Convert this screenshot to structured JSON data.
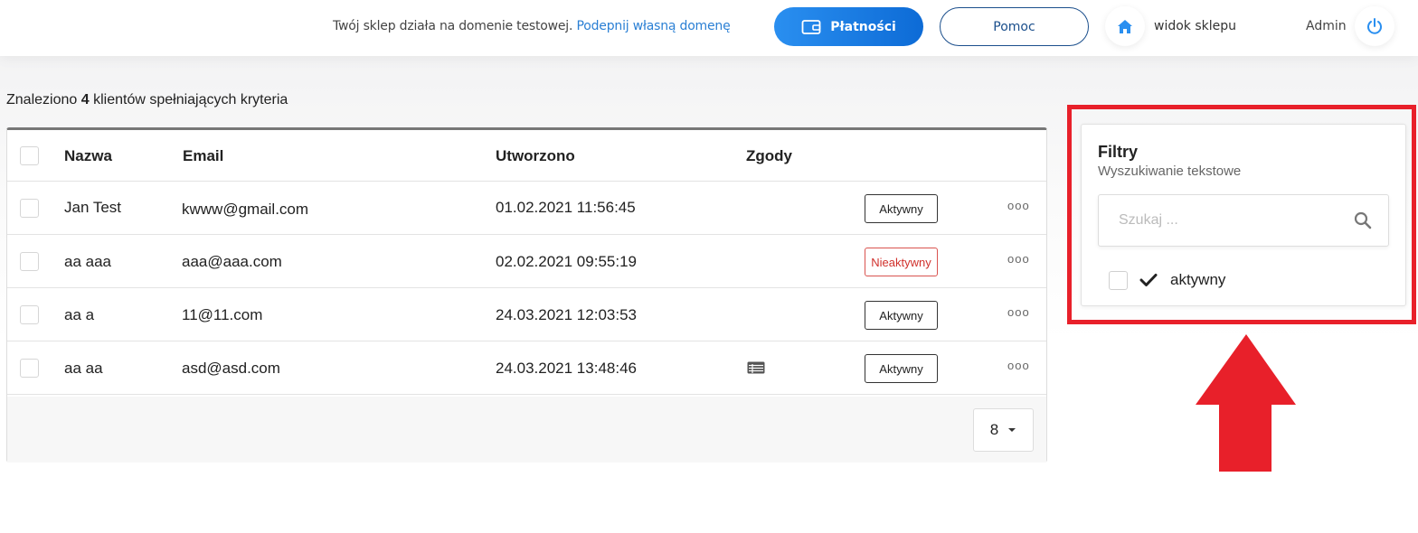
{
  "topbar": {
    "domain_notice": "Twój sklep działa na domenie testowej.",
    "domain_link": "Podepnij własną domenę",
    "payments_label": "Płatności",
    "help_label": "Pomoc",
    "shop_view_label": "widok sklepu",
    "admin_label": "Admin"
  },
  "results": {
    "prefix": "Znaleziono",
    "count": "4",
    "suffix": "klientów spełniających kryteria"
  },
  "table": {
    "headers": {
      "name": "Nazwa",
      "email": "Email",
      "created": "Utworzono",
      "consents": "Zgody"
    },
    "rows": [
      {
        "name": "Jan Test",
        "email": "kwww@gmail.com",
        "created": "01.02.2021 11:56:45",
        "status": "Aktywny",
        "has_consent_icon": false
      },
      {
        "name": "aa aaa",
        "email": "aaa@aaa.com",
        "created": "02.02.2021 09:55:19",
        "status": "Nieaktywny",
        "has_consent_icon": false
      },
      {
        "name": "aa a",
        "email": "11@11.com",
        "created": "24.03.2021 12:03:53",
        "status": "Aktywny",
        "has_consent_icon": false
      },
      {
        "name": "aa aa",
        "email": "asd@asd.com",
        "created": "24.03.2021 13:48:46",
        "status": "Aktywny",
        "has_consent_icon": true
      }
    ],
    "row_menu_glyph": "ooo",
    "page_size": "8"
  },
  "filters": {
    "title": "Filtry",
    "subtitle": "Wyszukiwanie tekstowe",
    "search_placeholder": "Szukaj ...",
    "option_label": "aktywny"
  },
  "colors": {
    "accent": "#0d6bd6",
    "link": "#2a7fd4",
    "inactive": "#d0302b",
    "highlight": "#e8202a"
  },
  "icons": [
    "wallet-icon",
    "home-icon",
    "power-icon",
    "search-icon",
    "check-icon",
    "caret-down-icon",
    "consent-list-icon",
    "up-arrow-annotation"
  ]
}
